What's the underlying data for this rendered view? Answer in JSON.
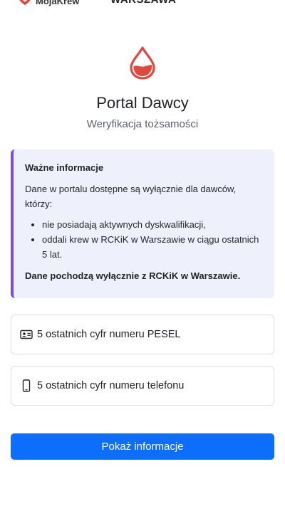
{
  "header": {
    "brand": "MojaKrew",
    "city": "WARSZAWA"
  },
  "hero": {
    "icon": "blood-drop-icon",
    "title": "Portal Dawcy",
    "subtitle": "Weryfikacja tożsamości"
  },
  "info": {
    "heading": "Ważne informacje",
    "intro": "Dane w portalu dostępne są wyłącznie dla dawców, którzy:",
    "items": [
      "nie posiadają aktywnych dyskwalifikacji,",
      "oddali krew w RCKiK w Warszawie w ciągu ostatnich 5 lat."
    ],
    "footer": "Dane pochodzą wyłącznie z RCKiK w Warszawie."
  },
  "form": {
    "pesel": {
      "icon": "id-card-icon",
      "placeholder": "5 ostatnich cyfr numeru PESEL",
      "value": ""
    },
    "phone": {
      "icon": "phone-icon",
      "placeholder": "5 ostatnich cyfr numeru telefonu",
      "value": ""
    },
    "submit_label": "Pokaż informacje"
  },
  "colors": {
    "accent": "#0d6efd",
    "brand_red": "#e0483f",
    "info_border": "#7a4fd6",
    "info_background": "#eef1fb"
  }
}
